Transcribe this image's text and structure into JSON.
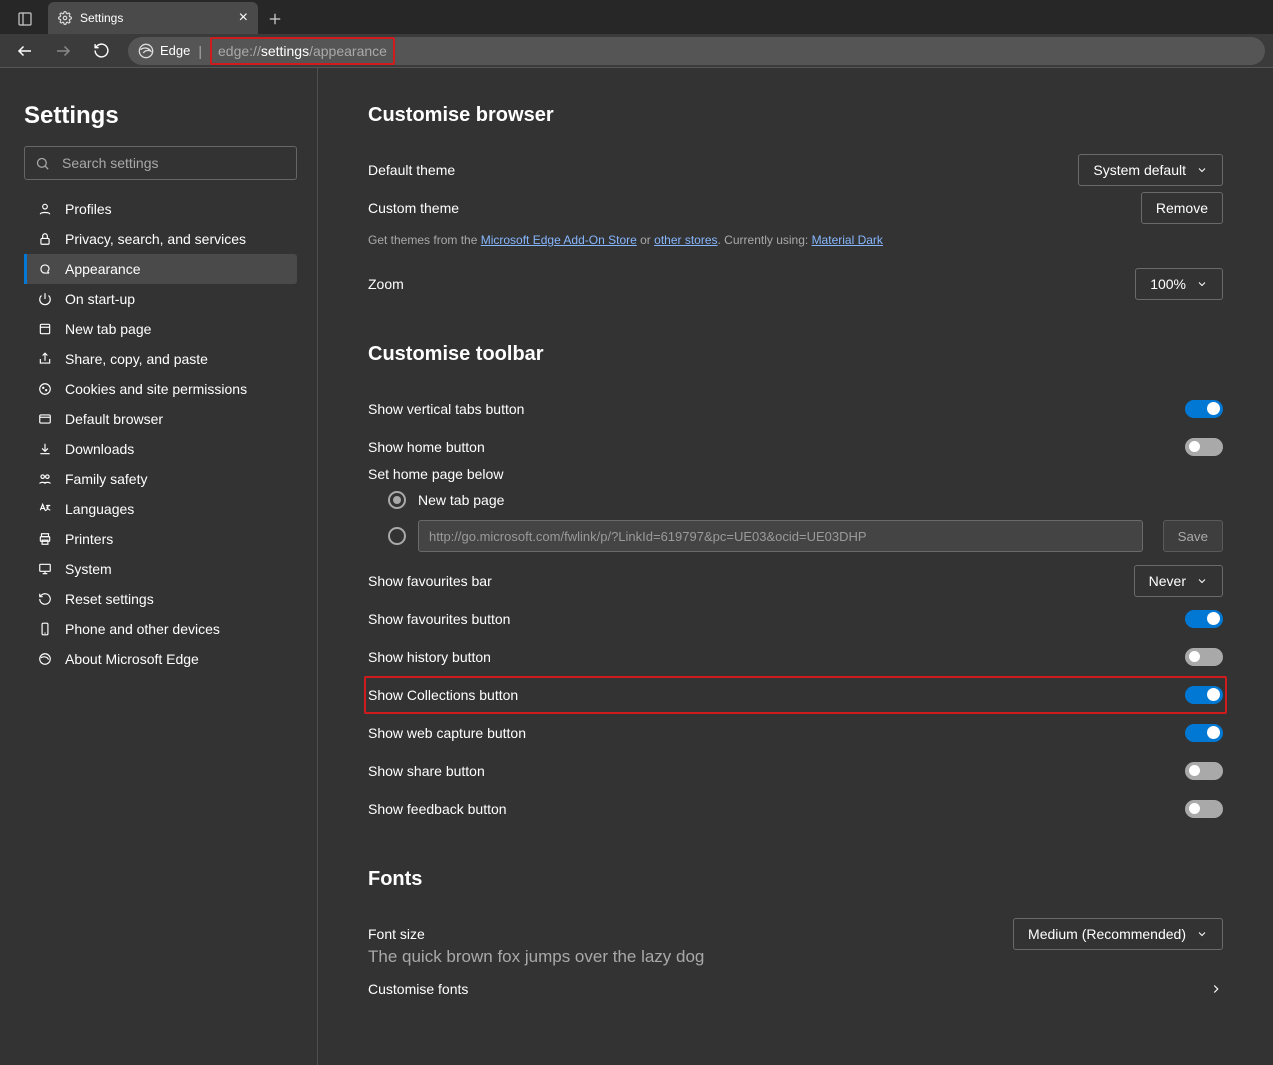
{
  "tab": {
    "title": "Settings"
  },
  "address": {
    "chip": "Edge",
    "pre": "edge://",
    "mid": "settings",
    "post": "/appearance"
  },
  "sidebar": {
    "title": "Settings",
    "search_placeholder": "Search settings",
    "items": [
      "Profiles",
      "Privacy, search, and services",
      "Appearance",
      "On start-up",
      "New tab page",
      "Share, copy, and paste",
      "Cookies and site permissions",
      "Default browser",
      "Downloads",
      "Family safety",
      "Languages",
      "Printers",
      "System",
      "Reset settings",
      "Phone and other devices",
      "About Microsoft Edge"
    ]
  },
  "sections": {
    "customise_browser": {
      "heading": "Customise browser",
      "default_theme_label": "Default theme",
      "default_theme_value": "System default",
      "custom_theme_label": "Custom theme",
      "custom_theme_remove": "Remove",
      "custom_theme_pre": "Get themes from the ",
      "custom_theme_link1": "Microsoft Edge Add-On Store",
      "custom_theme_or": " or ",
      "custom_theme_link2": "other stores",
      "custom_theme_using": ". Currently using: ",
      "custom_theme_link3": "Material Dark",
      "zoom_label": "Zoom",
      "zoom_value": "100%"
    },
    "customise_toolbar": {
      "heading": "Customise toolbar",
      "vertical_tabs": "Show vertical tabs button",
      "home_button": "Show home button",
      "home_sub": "Set home page below",
      "home_newtab": "New tab page",
      "home_url_placeholder": "http://go.microsoft.com/fwlink/p/?LinkId=619797&pc=UE03&ocid=UE03DHP",
      "home_save": "Save",
      "fav_bar": "Show favourites bar",
      "fav_bar_value": "Never",
      "fav_btn": "Show favourites button",
      "history_btn": "Show history button",
      "collections_btn": "Show Collections button",
      "web_capture": "Show web capture button",
      "share": "Show share button",
      "feedback": "Show feedback button"
    },
    "fonts": {
      "heading": "Fonts",
      "size_label": "Font size",
      "size_value": "Medium (Recommended)",
      "sample": "The quick brown fox jumps over the lazy dog",
      "customise": "Customise fonts"
    }
  }
}
